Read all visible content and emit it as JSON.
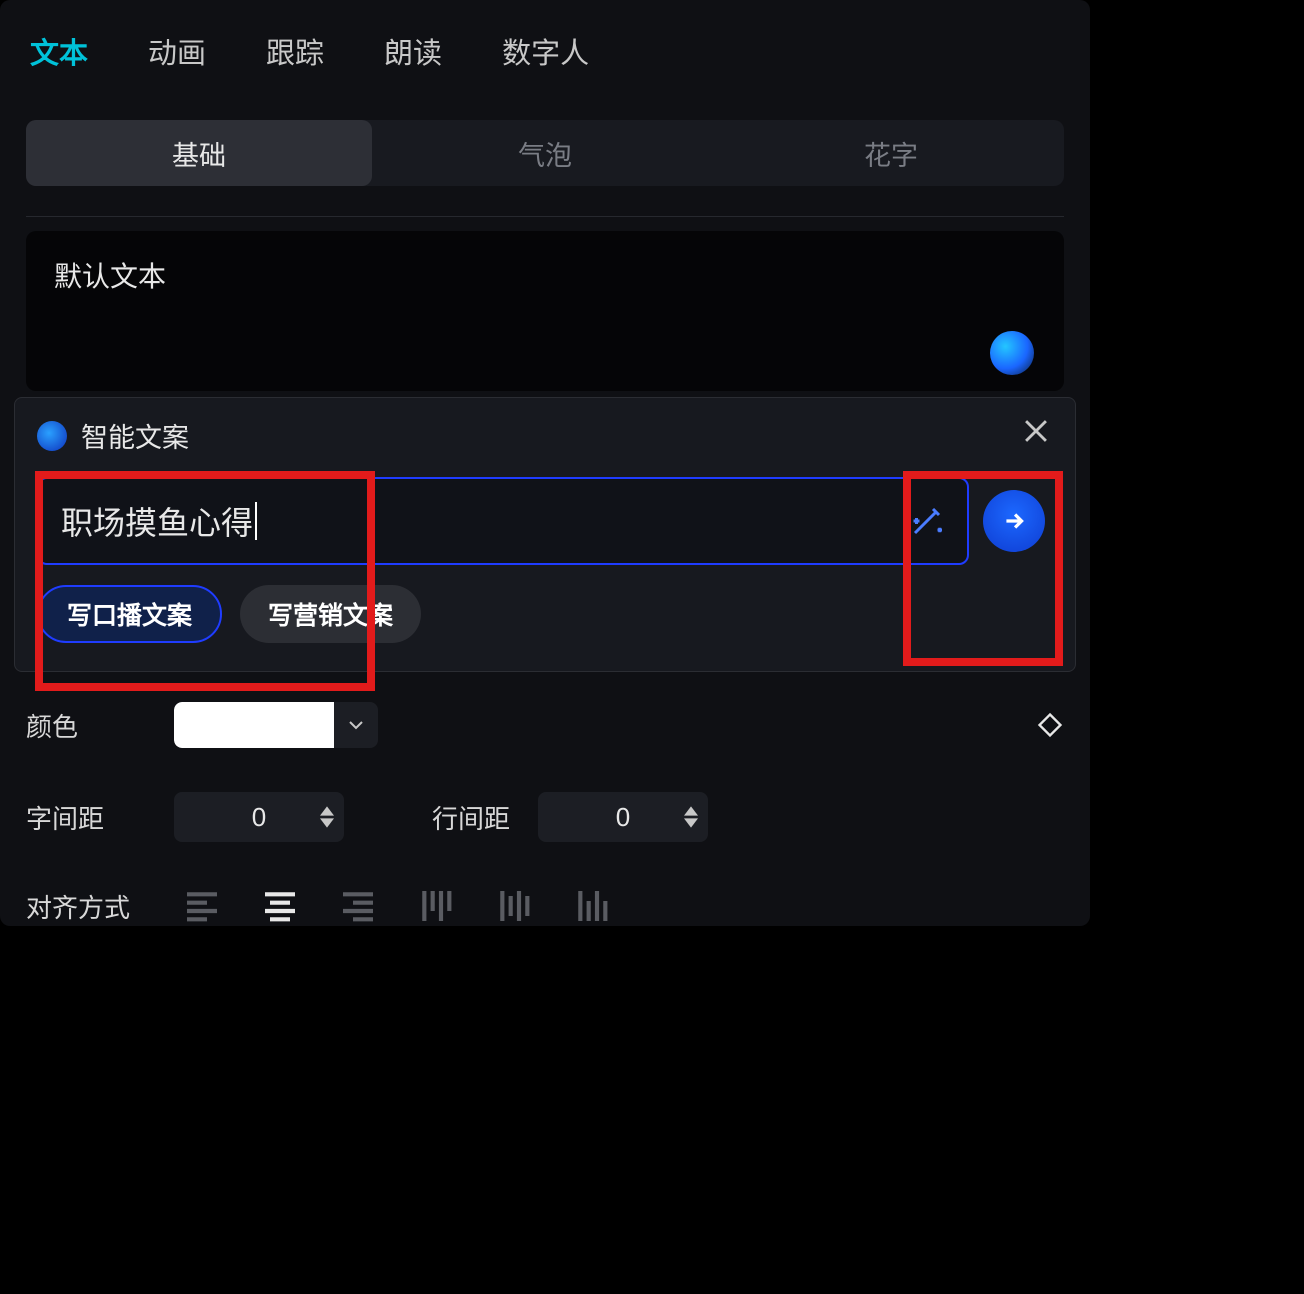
{
  "topTabs": {
    "text": "文本",
    "animation": "动画",
    "track": "跟踪",
    "read": "朗读",
    "digital": "数字人"
  },
  "subTabs": {
    "basic": "基础",
    "bubble": "气泡",
    "fancy": "花字"
  },
  "textBox": {
    "default": "默认文本"
  },
  "smartCopy": {
    "title": "智能文案",
    "input": "职场摸鱼心得",
    "chip1": "写口播文案",
    "chip2": "写营销文案"
  },
  "props": {
    "color": "颜色",
    "letterSpacing": "字间距",
    "letterSpacingValue": "0",
    "lineSpacing": "行间距",
    "lineSpacingValue": "0",
    "align": "对齐方式"
  }
}
